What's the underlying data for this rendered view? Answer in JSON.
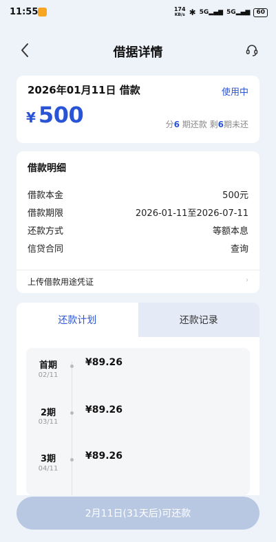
{
  "status_bar": {
    "time": "11:55",
    "net_speed_value": "174",
    "net_speed_unit": "KB/s",
    "bluetooth_glyph": "✱",
    "signal1": "5G",
    "signal2": "5G",
    "battery": "60"
  },
  "header": {
    "title": "借据详情",
    "back_icon": "chevron-left-icon",
    "service_icon": "customer-service-icon"
  },
  "summary": {
    "date_text": "2026年01月11日 借款",
    "status": "使用中",
    "currency": "¥",
    "amount": "500",
    "periods_prefix": "分",
    "periods_total": "6",
    "periods_mid": "期还款 剩",
    "periods_left": "6",
    "periods_suffix": "期未还"
  },
  "detail": {
    "title": "借款明细",
    "rows": [
      {
        "label": "借款本金",
        "value": "500元"
      },
      {
        "label": "借款期限",
        "value": "2026-01-11至2026-07-11"
      },
      {
        "label": "还款方式",
        "value": "等额本息"
      },
      {
        "label": "信贷合同",
        "value": "查询"
      }
    ],
    "upload_label": "上传借款用途凭证",
    "upload_chevron": "›"
  },
  "tabs": [
    {
      "label": "还款计划",
      "active": true
    },
    {
      "label": "还款记录",
      "active": false
    }
  ],
  "schedule": [
    {
      "period": "首期",
      "date": "02/11",
      "amount": "¥89.26"
    },
    {
      "period": "2期",
      "date": "03/11",
      "amount": "¥89.26"
    },
    {
      "period": "3期",
      "date": "04/11",
      "amount": "¥89.26"
    }
  ],
  "repay_button": "2月11日(31天后)可还款",
  "colors": {
    "accent": "#2a54d6",
    "background": "#eef2f9",
    "button_disabled": "#b9c8e2"
  }
}
